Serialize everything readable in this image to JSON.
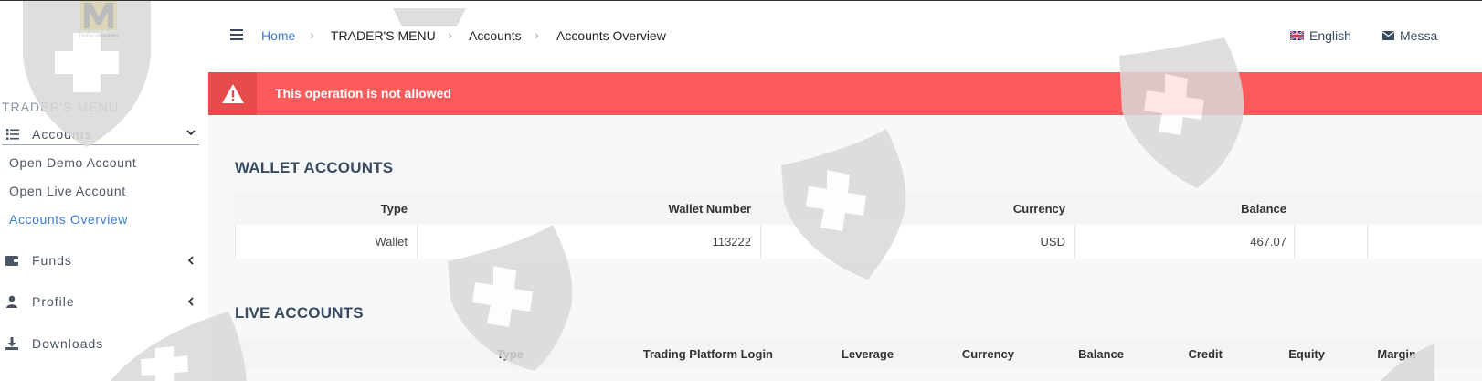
{
  "brand": {
    "logo_text": "DollarsMarkets"
  },
  "sidebar": {
    "menu_title": "TRADER'S MENU",
    "accounts_group": {
      "label": "Accounts",
      "icon": "list-icon"
    },
    "sub_items": [
      {
        "label": "Open Demo Account"
      },
      {
        "label": "Open Live Account"
      },
      {
        "label": "Accounts Overview",
        "active": true
      }
    ],
    "items": [
      {
        "label": "Funds",
        "icon": "wallet-icon"
      },
      {
        "label": "Profile",
        "icon": "user-icon"
      },
      {
        "label": "Downloads",
        "icon": "download-icon"
      }
    ]
  },
  "topbar": {
    "breadcrumb": [
      "Home",
      "TRADER'S MENU",
      "Accounts",
      "Accounts Overview"
    ],
    "language": "English",
    "messages": "Messa"
  },
  "alert": {
    "text": "This operation is not allowed",
    "color": "#fd5b5b"
  },
  "wallet_accounts": {
    "title": "WALLET ACCOUNTS",
    "columns": [
      "Type",
      "Wallet Number",
      "Currency",
      "Balance"
    ],
    "rows": [
      {
        "type": "Wallet",
        "wallet_number": "113222",
        "currency": "USD",
        "balance": "467.07"
      }
    ]
  },
  "live_accounts": {
    "title": "LIVE ACCOUNTS",
    "columns": [
      "Type",
      "Trading Platform Login",
      "Leverage",
      "Currency",
      "Balance",
      "Credit",
      "Equity",
      "Margin"
    ]
  },
  "colors": {
    "accent": "#3a7bd5",
    "heading": "#3a4a5e",
    "alert": "#fd5b5b"
  }
}
